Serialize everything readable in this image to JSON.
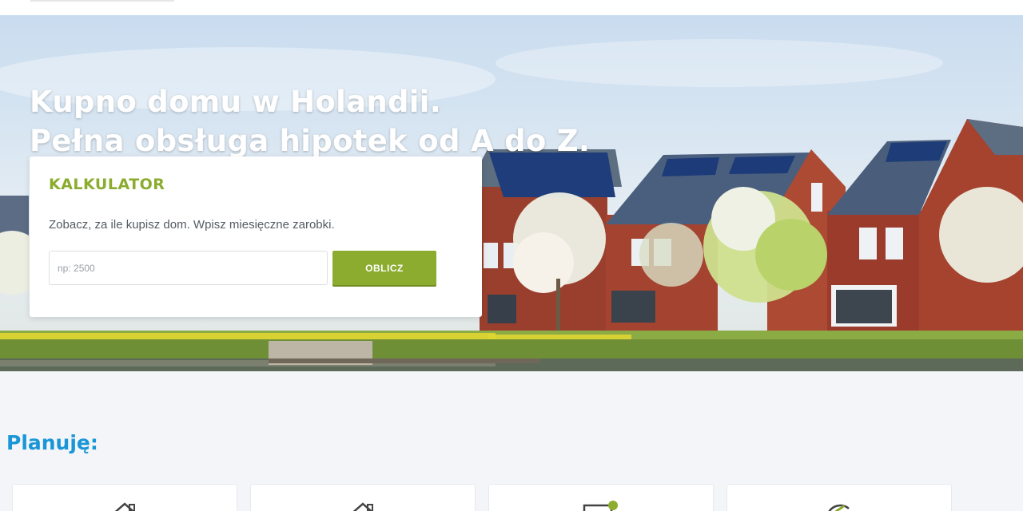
{
  "hero": {
    "title_line1": "Kupno domu w Holandii.",
    "title_line2": "Pełna obsługa hipotek od A do Z."
  },
  "calculator": {
    "title": "KALKULATOR",
    "description": "Zobacz, za ile kupisz dom. Wpisz miesięczne zarobki.",
    "input_placeholder": "np: 2500",
    "input_value": "",
    "button_label": "OBLICZ"
  },
  "plans": {
    "title": "Planuję:",
    "cards": [
      {
        "icon": "house-icon"
      },
      {
        "icon": "house-icon"
      },
      {
        "icon": "document-check-icon"
      },
      {
        "icon": "leaf-icon"
      }
    ]
  },
  "colors": {
    "accent_green": "#8bac2e",
    "heading_blue": "#1a96d6",
    "background": "#f3f5f9"
  }
}
